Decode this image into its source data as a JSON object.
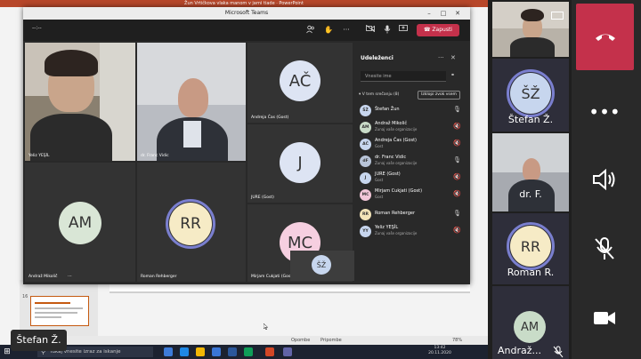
{
  "powerpoint": {
    "title_bar": "Žun Vrtičkova vlaka manom v jarni tiade · PowerPoint",
    "slide_number": "16",
    "status_notes": "Opombe",
    "status_comments": "Pripombe",
    "zoom": "78%"
  },
  "taskbar": {
    "search_placeholder": "Tukaj vnesite izraz za iskanje",
    "time": "13:42",
    "date": "20.11.2020"
  },
  "teams": {
    "window_title": "Microsoft Teams",
    "timer": "--:--",
    "leave_label": "Zapusti",
    "tiles": [
      {
        "label": "Yeliz YEŞİL",
        "initials": ""
      },
      {
        "label": "dr. Franc Vidic",
        "initials": ""
      },
      {
        "label": "Andreja Čas (Gost)",
        "initials": "AČ"
      },
      {
        "label": "JURE (Gost)",
        "initials": "J"
      },
      {
        "label": "Andraž Mikolič",
        "initials": "AM"
      },
      {
        "label": "Roman Rehberger",
        "initials": "RR"
      },
      {
        "label": "Mirjam Cukjati (Gost)",
        "initials": "MC"
      }
    ],
    "self_preview_initials": "ŠŽ",
    "participants": {
      "title": "Udeleženci",
      "invite_placeholder": "Vnesite ime",
      "section": "V tem srečanju (8)",
      "mute_all": "Izklopi zvok vsem",
      "people": [
        {
          "initials": "ŠŽ",
          "name": "Štefan Žun",
          "role": "",
          "color": "#c7d6ee"
        },
        {
          "initials": "AM",
          "name": "Andraž Mikolič",
          "role": "Zunaj vaše organizacije",
          "color": "#c9dcc8"
        },
        {
          "initials": "AČ",
          "name": "Andreja Čas (Gost)",
          "role": "Gost",
          "color": "#c7d6ee"
        },
        {
          "initials": "dF",
          "name": "dr. Franc Vidic",
          "role": "Zunaj vaše organizacije",
          "color": "#b8c4d8"
        },
        {
          "initials": "J",
          "name": "JURE (Gost)",
          "role": "Gost",
          "color": "#c7d6ee"
        },
        {
          "initials": "MC",
          "name": "Mirjam Cukjati (Gost)",
          "role": "Gost",
          "color": "#f2c6d8"
        },
        {
          "initials": "RR",
          "name": "Roman Rehberger",
          "role": "",
          "color": "#f3e4b8"
        },
        {
          "initials": "YY",
          "name": "Yeliz YEŞİL",
          "role": "Zunaj vaše organizacije",
          "color": "#c7d6ee"
        }
      ]
    }
  },
  "sidebar": {
    "tiles": [
      {
        "name": "",
        "initials": ""
      },
      {
        "name": "Štefan Ž.",
        "initials": "ŠŽ"
      },
      {
        "name": "dr. F.",
        "initials": ""
      },
      {
        "name": "Roman R.",
        "initials": "RR"
      },
      {
        "name": "Andraž...",
        "initials": "AM"
      }
    ]
  },
  "name_overlay": "Štefan Ž."
}
